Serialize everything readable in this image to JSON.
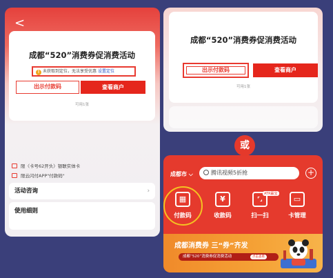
{
  "left_panel": {
    "back_glyph": "<",
    "title": "成都“520”消费券促消费活动",
    "notice": {
      "text": "未获取到定位，无法享受优惠",
      "link": "设置定位",
      "warn_glyph": "!"
    },
    "pay_button": "出示付款码",
    "shop_button": "查看商户",
    "availability": "可用1张",
    "rules": [
      "限〈卡号62开头〉银联实体卡",
      "限云闪付APP\"付款码\""
    ],
    "consult_label": "活动咨询",
    "chevron": "›",
    "detail_label": "使用细则"
  },
  "right_top": {
    "title": "成都“520”消费券促消费活动",
    "pay_button": "出示付款码",
    "shop_button": "查看商户",
    "availability": "可用1张"
  },
  "or_label": "或",
  "right_bottom": {
    "city": "成都市 ⌵",
    "search_placeholder": "腾讯视频5折抢",
    "plus_glyph": "+",
    "quick_actions": [
      {
        "label": "付款码",
        "glyph": "▦"
      },
      {
        "label": "收款码",
        "glyph": "¥"
      },
      {
        "label": "扫一扫",
        "glyph": "⌜⌟"
      },
      {
        "label": "卡管理",
        "glyph": "▭"
      }
    ],
    "scan_badge": "ATR赢宝",
    "banner_title": "成都消费券 三“券”齐发",
    "banner_sub": "成都“520”消费券促消费活动",
    "banner_tag": "点击查看"
  },
  "colors": {
    "brand_red": "#e5261c",
    "highlight_ring": "#f4c322",
    "background": "#3a3f7a"
  }
}
